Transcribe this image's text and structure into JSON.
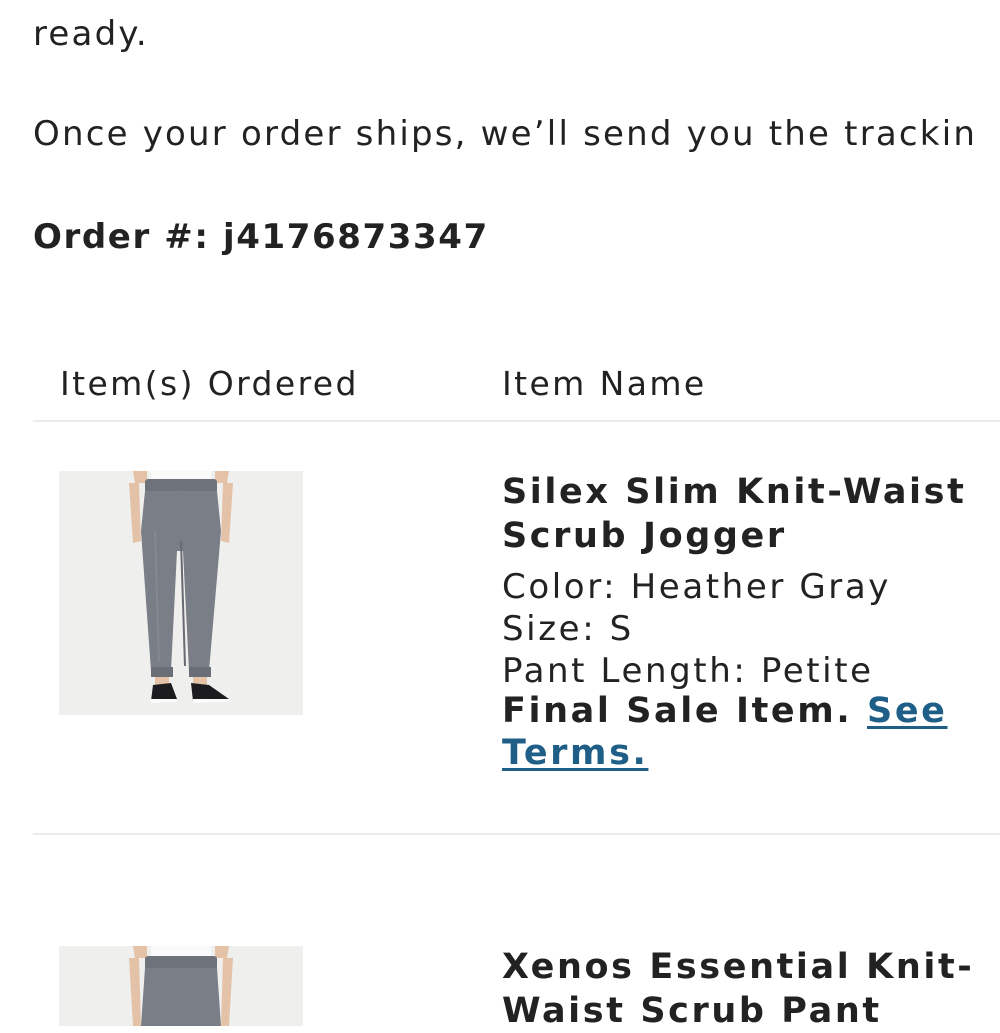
{
  "intro": {
    "line1": "ready.",
    "line2": "Once your order ships, we’ll send you the trackin"
  },
  "order": {
    "label": "Order #: j4176873347"
  },
  "table": {
    "headers": [
      "Item(s) Ordered",
      "Item Name"
    ]
  },
  "items": [
    {
      "title_line1": "Silex Slim Knit-Waist",
      "title_line2": "Scrub Jogger",
      "color": "Color: Heather Gray",
      "size": "Size: S",
      "length": "Pant Length: Petite",
      "final_sale": "Final Sale Item.",
      "terms_part1": "See",
      "terms_part2": "Terms."
    },
    {
      "title_line1": "Xenos Essential Knit-",
      "title_line2": "Waist Scrub Pant"
    }
  ],
  "colors": {
    "text": "#222222",
    "link": "#1f5e86",
    "divider": "#ececec",
    "image_bg": "#efefee"
  }
}
